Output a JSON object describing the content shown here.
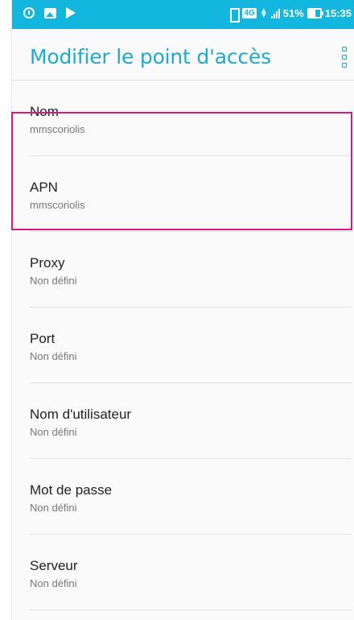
{
  "status_bar": {
    "network_badge": "4G",
    "battery_percent": "51%",
    "time": "15:35",
    "icons": [
      "alarm-icon",
      "image-icon",
      "play-icon",
      "vibrate-icon",
      "data-arrows-icon",
      "signal-icon",
      "battery-icon"
    ],
    "background_color": "#12b6de"
  },
  "header": {
    "title": "Modifier le point d'accès",
    "menu_icon": "overflow-menu-icon",
    "accent_color": "#1ea9cf"
  },
  "settings": {
    "items": [
      {
        "label": "Nom",
        "value": "mmscoriolis"
      },
      {
        "label": "APN",
        "value": "mmscoriolis"
      },
      {
        "label": "Proxy",
        "value": "Non défini"
      },
      {
        "label": "Port",
        "value": "Non défini"
      },
      {
        "label": "Nom d'utilisateur",
        "value": "Non défini"
      },
      {
        "label": "Mot de passe",
        "value": "Non défini"
      },
      {
        "label": "Serveur",
        "value": "Non défini"
      }
    ]
  },
  "highlight_color": "#d61a7f"
}
